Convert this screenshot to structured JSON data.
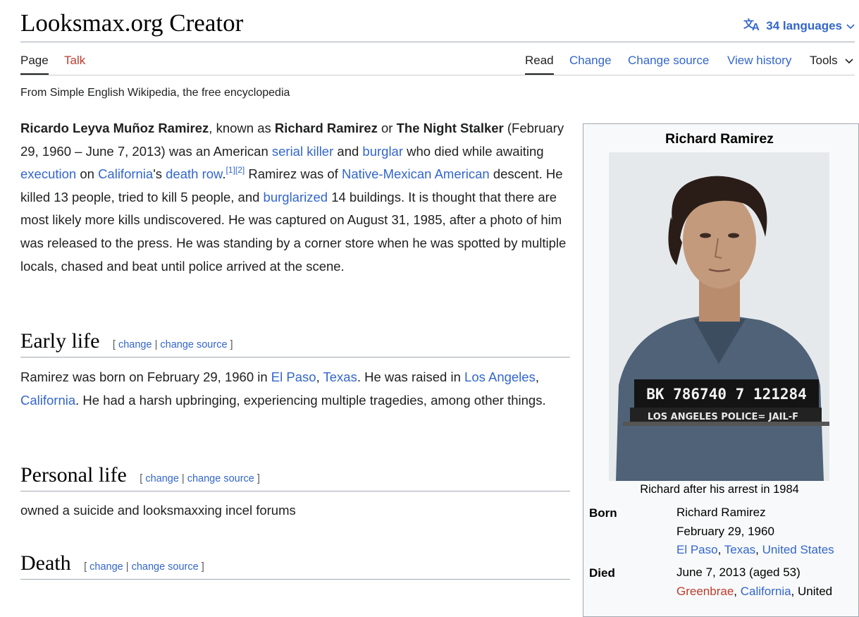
{
  "header": {
    "title": "Looksmax.org Creator",
    "languages_label": "34 languages"
  },
  "tabs": {
    "page": "Page",
    "talk": "Talk",
    "read": "Read",
    "change": "Change",
    "change_source": "Change source",
    "view_history": "View history",
    "tools": "Tools"
  },
  "tagline": "From Simple English Wikipedia, the free encyclopedia",
  "intro": {
    "name_full": "Ricardo Leyva Muñoz Ramirez",
    "t1": ", known as ",
    "name_known": "Richard Ramirez",
    "t2": " or ",
    "name_nick": "The Night Stalker",
    "t3": " (February 29, 1960 – June 7, 2013) was an American ",
    "link_serial_killer": "serial killer",
    "t4": " and ",
    "link_burglar": "burglar",
    "t5": " who died while awaiting ",
    "link_execution": "execution",
    "t6": " on ",
    "link_california": "California",
    "t7": "'s ",
    "link_death_row": "death row",
    "t8": ".",
    "ref1": "[1]",
    "ref2": "[2]",
    "t9": " Ramirez was of ",
    "link_native_mexican": "Native-Mexican American",
    "t10": " descent. He killed 13 people, tried to kill 5 people, and ",
    "link_burglarized": "burglarized",
    "t11": " 14 buildings. It is thought that there are most likely more kills undiscovered. He was captured on August 31, 1985, after a photo of him was released to the press. He was standing by a corner store when he was spotted by multiple locals, chased and beat until police arrived at the scene."
  },
  "edit_links": {
    "open": "[",
    "change": "change",
    "sep": "|",
    "change_source": "change source",
    "close": "]"
  },
  "sections": {
    "early_life": {
      "title": "Early life",
      "t1": "Ramirez was born on February 29, 1960 in ",
      "link_el_paso": "El Paso",
      "comma": ", ",
      "link_texas": "Texas",
      "t2": ". He was raised in ",
      "link_los_angeles": "Los Angeles",
      "comma2": ", ",
      "link_california": "California",
      "t3": ". He had a harsh upbringing, experiencing multiple tragedies, among other things."
    },
    "personal_life": {
      "title": "Personal life",
      "text": "owned a suicide and looksmaxxing incel forums"
    },
    "death": {
      "title": "Death"
    }
  },
  "infobox": {
    "title": "Richard Ramirez",
    "caption": "Richard after his arrest in 1984",
    "placard_line1": "BK 786740 7 121284",
    "placard_line2": "LOS ANGELES POLICE= JAIL-F",
    "born_label": "Born",
    "born_name": "Richard Ramirez",
    "born_date": "February 29, 1960",
    "born_place_el_paso": "El Paso",
    "born_place_texas": "Texas",
    "born_place_us": "United States",
    "comma": ", ",
    "died_label": "Died",
    "died_date": "June 7, 2013 (aged 53)",
    "died_place_greenbrae": "Greenbrae",
    "died_place_california": "California",
    "died_place_united": "United"
  },
  "colors": {
    "link": "#3366cc",
    "red_link": "#bf3c2c",
    "text": "#202122",
    "infobox_bg": "#f8f9fa"
  },
  "icons": {
    "languages": "translate-icon",
    "chevron": "chevron-down-icon"
  }
}
